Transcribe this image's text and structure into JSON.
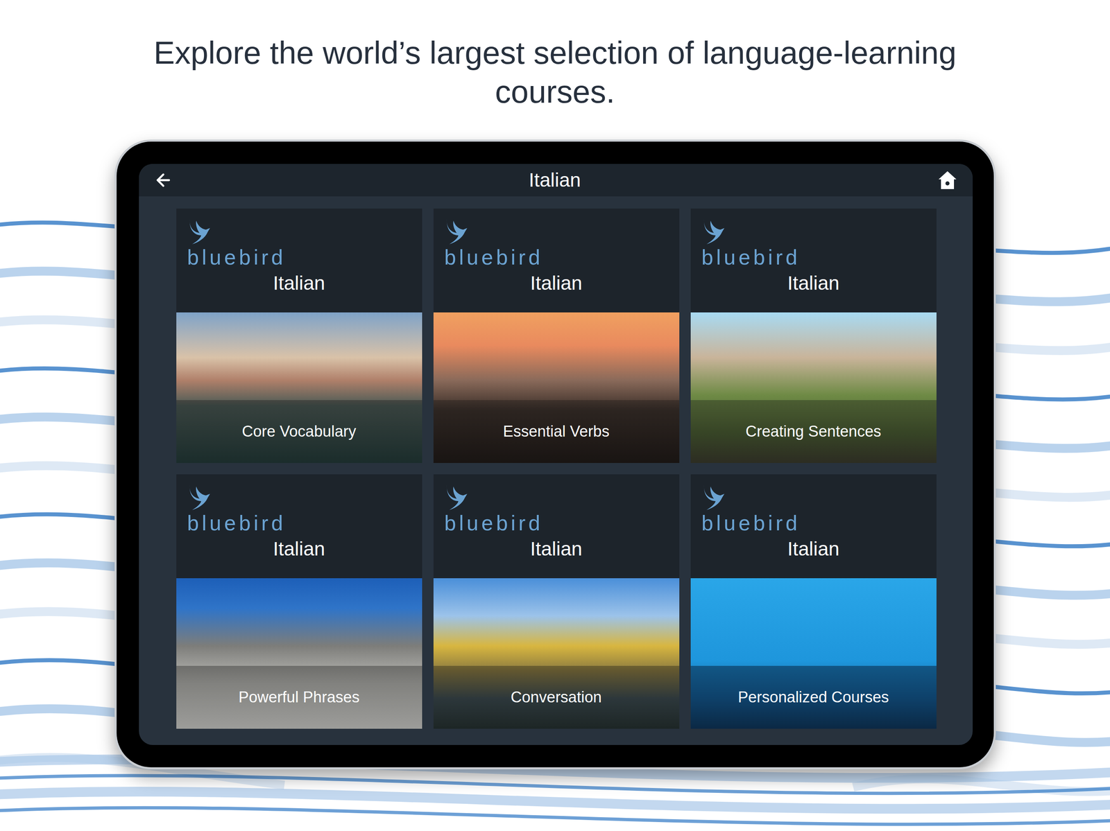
{
  "headline": "Explore the world’s largest selection of language-learning courses.",
  "header": {
    "title": "Italian"
  },
  "cards": [
    {
      "brand": "bluebird",
      "language": "Italian",
      "label": "Core Vocabulary"
    },
    {
      "brand": "bluebird",
      "language": "Italian",
      "label": "Essential Verbs"
    },
    {
      "brand": "bluebird",
      "language": "Italian",
      "label": "Creating Sentences"
    },
    {
      "brand": "bluebird",
      "language": "Italian",
      "label": "Powerful Phrases"
    },
    {
      "brand": "bluebird",
      "language": "Italian",
      "label": "Conversation"
    },
    {
      "brand": "bluebird",
      "language": "Italian",
      "label": "Personalized Courses"
    }
  ]
}
